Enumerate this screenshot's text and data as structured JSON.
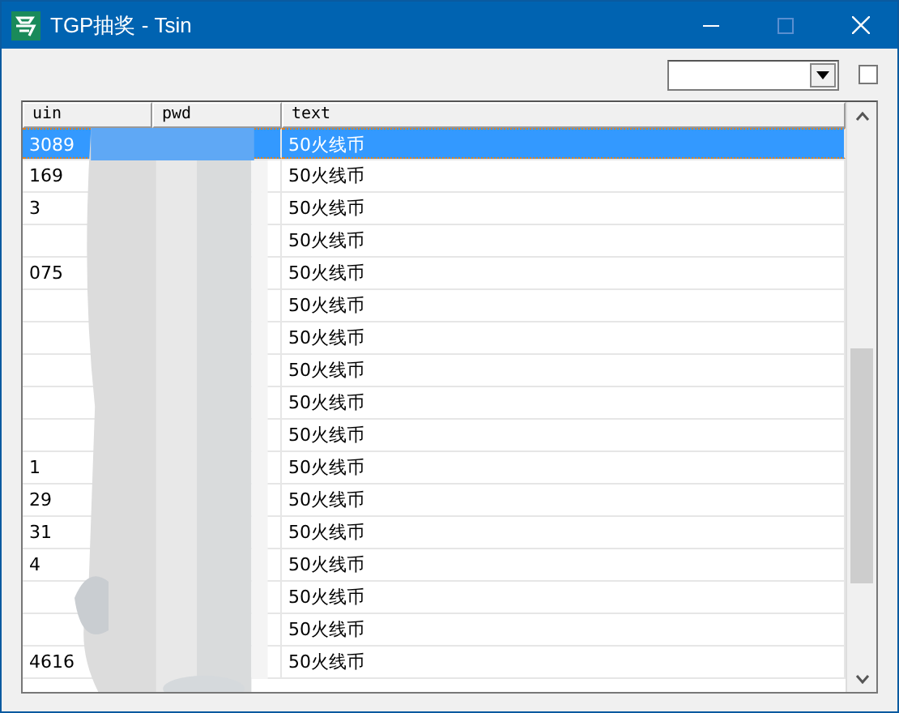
{
  "window": {
    "title": "TGP抽奖 - Tsin"
  },
  "checkbox": {
    "checked": false
  },
  "table": {
    "columns": [
      "uin",
      "pwd",
      "text"
    ],
    "rows": [
      {
        "uin": "3089",
        "text": "50火线币",
        "selected": true
      },
      {
        "uin": "169",
        "text": "50火线币",
        "selected": false
      },
      {
        "uin": "3",
        "text": "50火线币",
        "selected": false
      },
      {
        "text": "50火线币",
        "selected": false
      },
      {
        "uin": "075",
        "text": "50火线币",
        "selected": false
      },
      {
        "text": "50火线币",
        "selected": false
      },
      {
        "text": "50火线币",
        "selected": false
      },
      {
        "text": "50火线币",
        "selected": false
      },
      {
        "text": "50火线币",
        "selected": false
      },
      {
        "text": "50火线币",
        "selected": false
      },
      {
        "uin": "1",
        "text": "50火线币",
        "selected": false
      },
      {
        "uin": "29",
        "text": "50火线币",
        "selected": false
      },
      {
        "uin": "31",
        "text": "50火线币",
        "selected": false
      },
      {
        "uin": "4",
        "text": "50火线币",
        "selected": false
      },
      {
        "text": "50火线币",
        "selected": false
      },
      {
        "text": "50火线币",
        "selected": false
      },
      {
        "uin": "4616",
        "text": "50火线币",
        "selected": false
      }
    ]
  }
}
